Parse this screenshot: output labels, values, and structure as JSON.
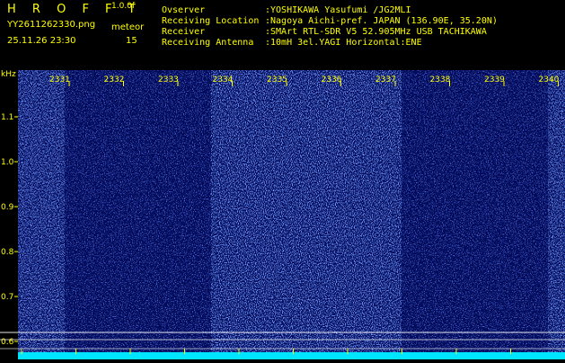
{
  "header": {
    "app_title": "H R O F F T",
    "version": "1.0.0f",
    "filename": "YY2611262330.png",
    "datetime": "25.11.26 23:30",
    "meteor_label": "meteor",
    "meteor_count": "15"
  },
  "info": [
    {
      "key": "Ovserver",
      "value": ":YOSHIKAWA Yasufumi /JG2MLI"
    },
    {
      "key": "Receiving Location",
      "value": ":Nagoya Aichi-pref. JAPAN (136.90E, 35.20N)"
    },
    {
      "key": "Receiver",
      "value": ":SMArt RTL-SDR V5 52.905MHz USB TACHIKAWA"
    },
    {
      "key": "Receiving Antenna",
      "value": ":10mH 3el.YAGI Horizontal:ENE"
    }
  ],
  "spectrogram": {
    "y_unit": "kHz",
    "y_ticks": [
      "1.1",
      "1.0",
      "0.9",
      "0.8",
      "0.7",
      "0.6"
    ],
    "x_ticks": [
      "2331",
      "2332",
      "2333",
      "2334",
      "2335",
      "2336",
      "2337",
      "2338",
      "2339",
      "2340"
    ],
    "colors": {
      "background": "#000000",
      "noise_dark": "#0a1a9a",
      "noise_bright": "#2e4ee0",
      "floor": "#00e5ff",
      "label": "#ffff00",
      "line": "#ffffff"
    }
  }
}
